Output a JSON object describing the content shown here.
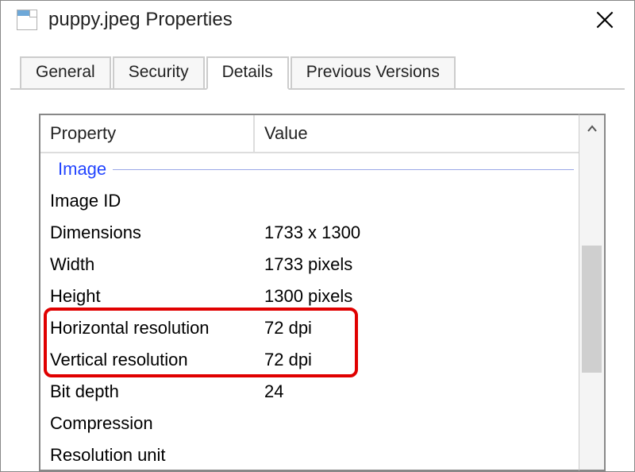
{
  "window": {
    "title": "puppy.jpeg Properties",
    "icon": "image-file-icon"
  },
  "tabs": [
    {
      "label": "General",
      "active": false
    },
    {
      "label": "Security",
      "active": false
    },
    {
      "label": "Details",
      "active": true
    },
    {
      "label": "Previous Versions",
      "active": false
    }
  ],
  "details": {
    "columns": {
      "property": "Property",
      "value": "Value"
    },
    "section": "Image",
    "rows": [
      {
        "property": "Image ID",
        "value": ""
      },
      {
        "property": "Dimensions",
        "value": "1733 x 1300"
      },
      {
        "property": "Width",
        "value": "1733 pixels"
      },
      {
        "property": "Height",
        "value": "1300 pixels"
      },
      {
        "property": "Horizontal resolution",
        "value": "72 dpi"
      },
      {
        "property": "Vertical resolution",
        "value": "72 dpi"
      },
      {
        "property": "Bit depth",
        "value": "24"
      },
      {
        "property": "Compression",
        "value": ""
      },
      {
        "property": "Resolution unit",
        "value": ""
      }
    ]
  },
  "highlight": {
    "color": "#e00000",
    "target_rows": [
      4,
      5
    ]
  }
}
